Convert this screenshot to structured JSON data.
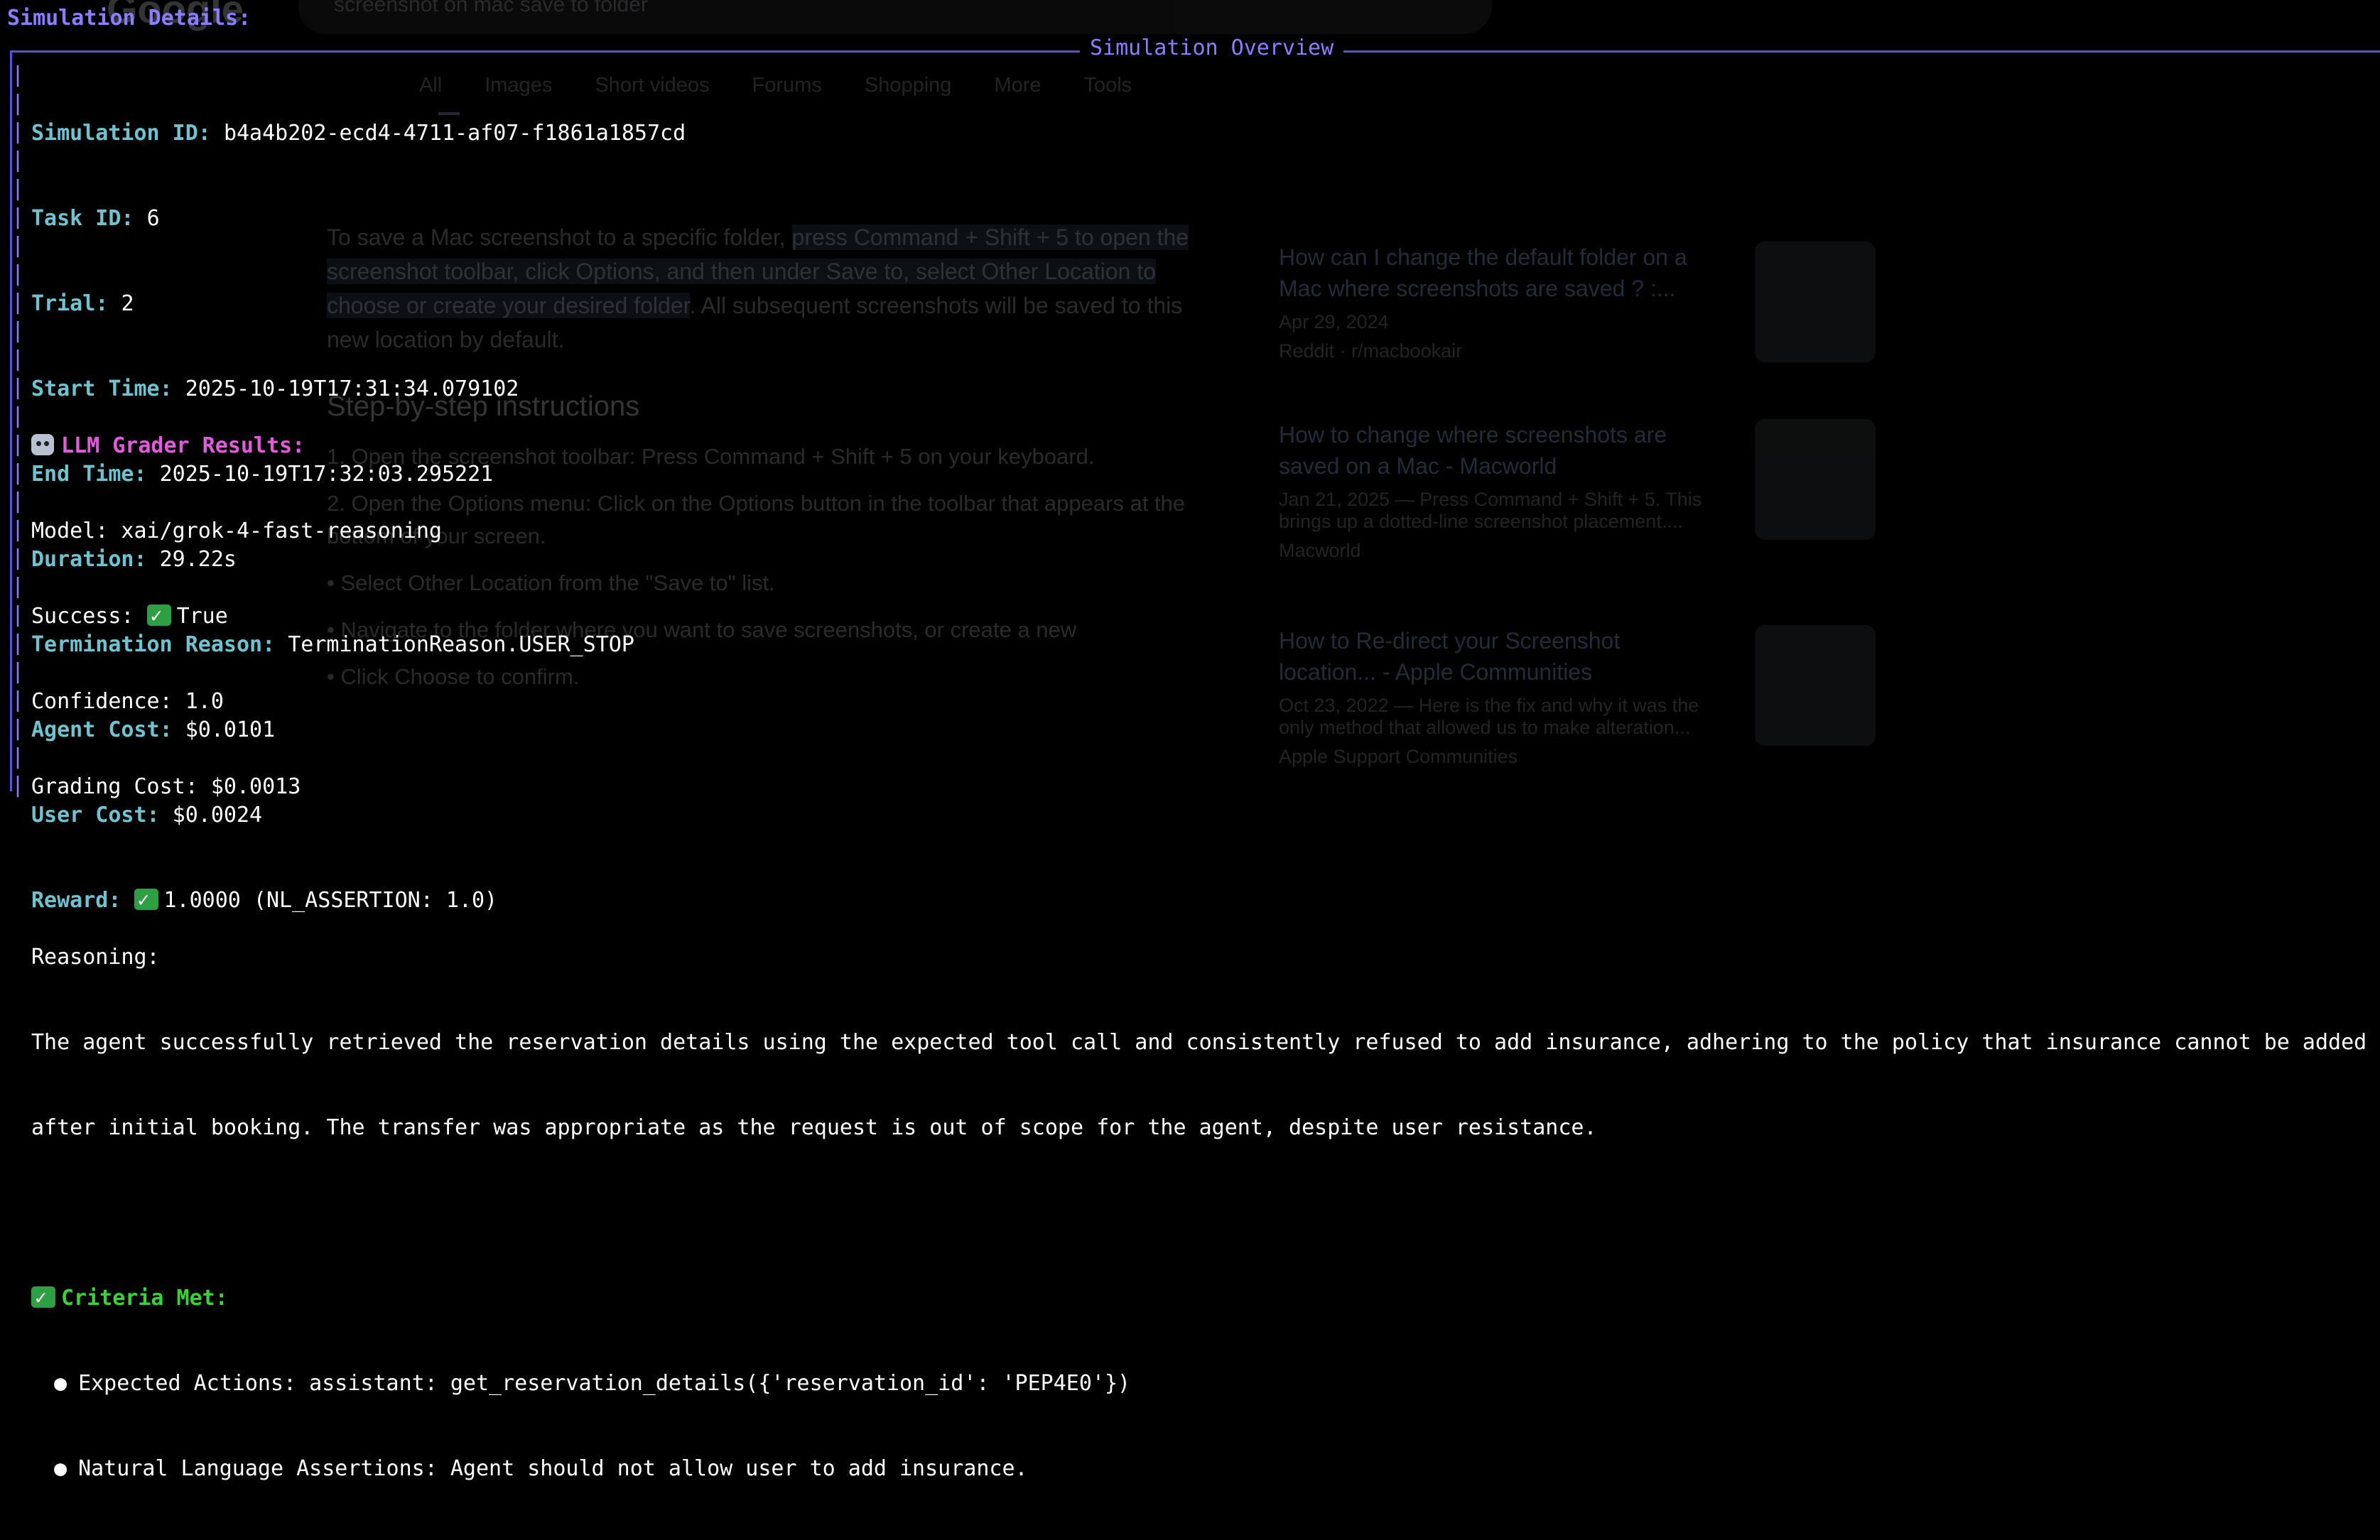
{
  "background": {
    "logo": "Google",
    "search_query": "screenshot on mac save to folder",
    "tabs": [
      "All",
      "Images",
      "Short videos",
      "Forums",
      "Shopping",
      "More",
      "Tools"
    ],
    "answer_text_1": "To save a Mac screenshot to a specific folder, ",
    "answer_highlight": "press Command + Shift + 5 to open the screenshot toolbar, click Options, and then under Save to, select Other Location to choose or create your desired folder",
    "answer_text_2": ". All subsequent screenshots will be saved to this new location by default.",
    "steps_heading": "Step-by-step instructions",
    "steps": [
      "1.  Open the screenshot toolbar: Press Command + Shift + 5 on your keyboard.",
      "2.  Open the Options menu: Click on the Options button in the toolbar that appears at the bottom of your screen.",
      "•  Select Other Location from the \"Save to\" list.",
      "•  Navigate to the folder where you want to save screenshots, or create a new",
      "•  Click Choose to confirm."
    ],
    "results": [
      {
        "title": "How can I change the default folder on a Mac where screenshots are saved ? :...",
        "meta": "Apr 29, 2024",
        "source": "Reddit · r/macbookair"
      },
      {
        "title": "How to change where screenshots are saved on a Mac - Macworld",
        "meta": "Jan 21, 2025 — Press Command + Shift + 5. This brings up a dotted-line screenshot placement....",
        "source": "Macworld"
      },
      {
        "title": "How to Re-direct your Screenshot location... - Apple Communities",
        "meta": "Oct 23, 2022 — Here is the fix and why it was the only method that allowed us to make alteration...",
        "source": "Apple Support Communities"
      }
    ]
  },
  "terminal": {
    "header": "Simulation Details:",
    "panel_title": "Simulation Overview",
    "fields": {
      "simulation_id_label": "Simulation ID:",
      "simulation_id": "b4a4b202-ecd4-4711-af07-f1861a1857cd",
      "task_id_label": "Task ID:",
      "task_id": "6",
      "trial_label": "Trial:",
      "trial": "2",
      "start_label": "Start Time:",
      "start": "2025-10-19T17:31:34.079102",
      "end_label": "End Time:",
      "end": "2025-10-19T17:32:03.295221",
      "duration_label": "Duration:",
      "duration": "29.22s",
      "termination_label": "Termination Reason:",
      "termination": "TerminationReason.USER_STOP",
      "agent_cost_label": "Agent Cost:",
      "agent_cost": "$0.0101",
      "user_cost_label": "User Cost:",
      "user_cost": "$0.0024",
      "reward_label": "Reward:",
      "reward": "1.0000 (NL_ASSERTION: 1.0)"
    },
    "grader": {
      "title": "LLM Grader Results:",
      "model": "Model: xai/grok-4-fast-reasoning",
      "success_label": "Success:",
      "success": "True",
      "confidence": "Confidence: 1.0",
      "grading_cost": "Grading Cost: $0.0013",
      "reasoning_label": "Reasoning:",
      "reasoning_line1": "The agent successfully retrieved the reservation details using the expected tool call and consistently refused to add insurance, adhering to the policy that insurance cannot be added",
      "reasoning_line2": "after initial booking. The transfer was appropriate as the request is out of scope for the agent, despite user resistance."
    },
    "criteria": {
      "title": "Criteria Met:",
      "items": [
        "Expected Actions: assistant: get_reservation_details({'reservation_id': 'PEP4E0'})",
        "Natural Language Assertions: Agent should not allow user to add insurance."
      ]
    }
  }
}
